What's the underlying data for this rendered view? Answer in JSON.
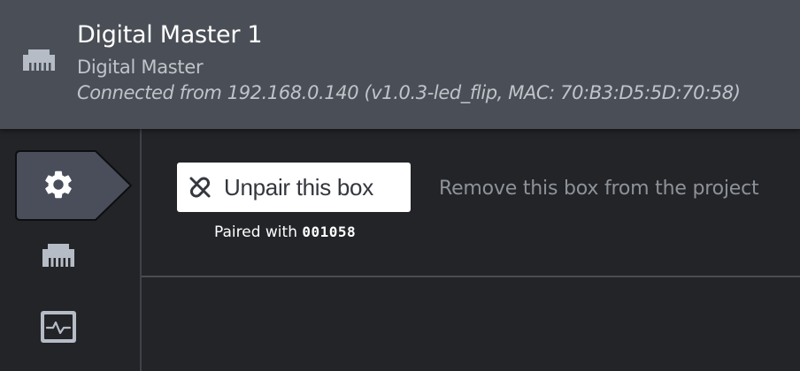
{
  "header": {
    "icon": "ethernet-port-icon",
    "title": "Digital Master 1",
    "subtitle": "Digital Master",
    "connection": "Connected from 192.168.0.140 (v1.0.3-led_flip, MAC: 70:B3:D5:5D:70:58)"
  },
  "sidebar": {
    "items": [
      {
        "id": "settings",
        "icon": "gear-icon",
        "active": true
      },
      {
        "id": "network",
        "icon": "ethernet-port-icon",
        "active": false
      },
      {
        "id": "monitor",
        "icon": "activity-monitor-icon",
        "active": false
      }
    ]
  },
  "main": {
    "unpair_button_label": "Unpair this box",
    "unpair_button_icon": "unlink-icon",
    "unpair_description": "Remove this box from the project",
    "paired_prefix": "Paired with ",
    "paired_code": "001058"
  },
  "colors": {
    "header_bg": "#4a4e56",
    "page_bg": "#232428",
    "active_tab_bg": "#4a4e5a",
    "button_bg": "#ffffff",
    "icon_gray": "#b6bcc6"
  }
}
